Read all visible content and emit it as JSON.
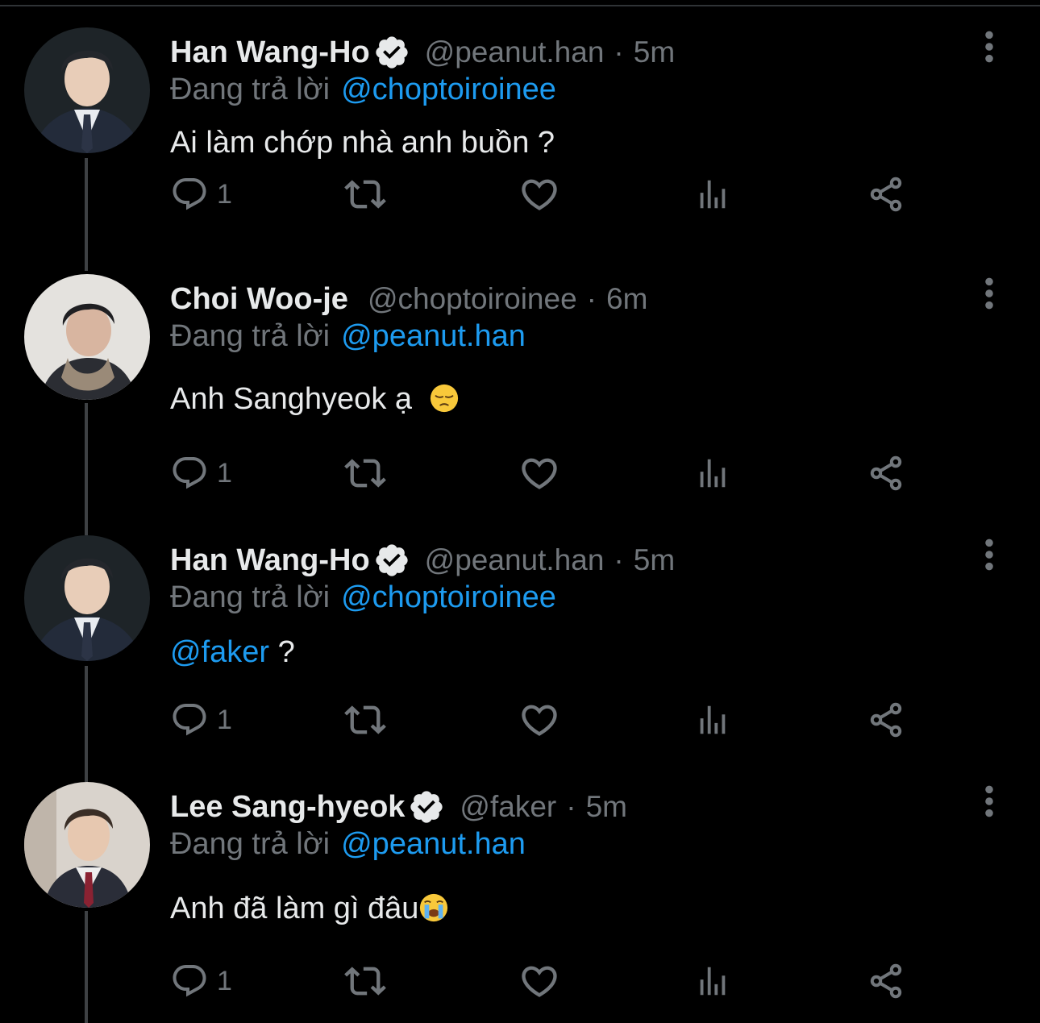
{
  "theme": {
    "background": "#000000",
    "text_primary": "#e7e9ea",
    "text_secondary": "#71767b",
    "accent": "#1d9bf0",
    "thread_line": "#3e4144"
  },
  "tweets": [
    {
      "name": "Han Wang-Ho",
      "verified": true,
      "handle": "@peanut.han",
      "separator": "·",
      "time": "5m",
      "reply_prefix": "Đang trả lời",
      "reply_to": "@choptoiroinee",
      "text": "Ai làm chớp nhà anh buồn ?",
      "reply_count": "1",
      "icons": [
        "reply-icon",
        "retweet-icon",
        "like-icon",
        "views-icon",
        "share-icon",
        "more-icon"
      ]
    },
    {
      "name": "Choi Woo-je",
      "verified": false,
      "handle": "@choptoiroinee",
      "separator": "·",
      "time": "6m",
      "reply_prefix": "Đang trả lời",
      "reply_to": "@peanut.han",
      "text": "Anh Sanghyeok ạ",
      "emoji": "pensive-face-emoji",
      "reply_count": "1"
    },
    {
      "name": "Han Wang-Ho",
      "verified": true,
      "handle": "@peanut.han",
      "separator": "·",
      "time": "5m",
      "reply_prefix": "Đang trả lời",
      "reply_to": "@choptoiroinee",
      "text_mention": "@faker",
      "text": " ?",
      "reply_count": "1"
    },
    {
      "name": "Lee Sang-hyeok",
      "verified": true,
      "handle": "@faker",
      "separator": "·",
      "time": "5m",
      "reply_prefix": "Đang trả lời",
      "reply_to": "@peanut.han",
      "text": "Anh đã làm gì đâu",
      "emoji": "loudly-crying-face-emoji",
      "reply_count": "1"
    }
  ]
}
